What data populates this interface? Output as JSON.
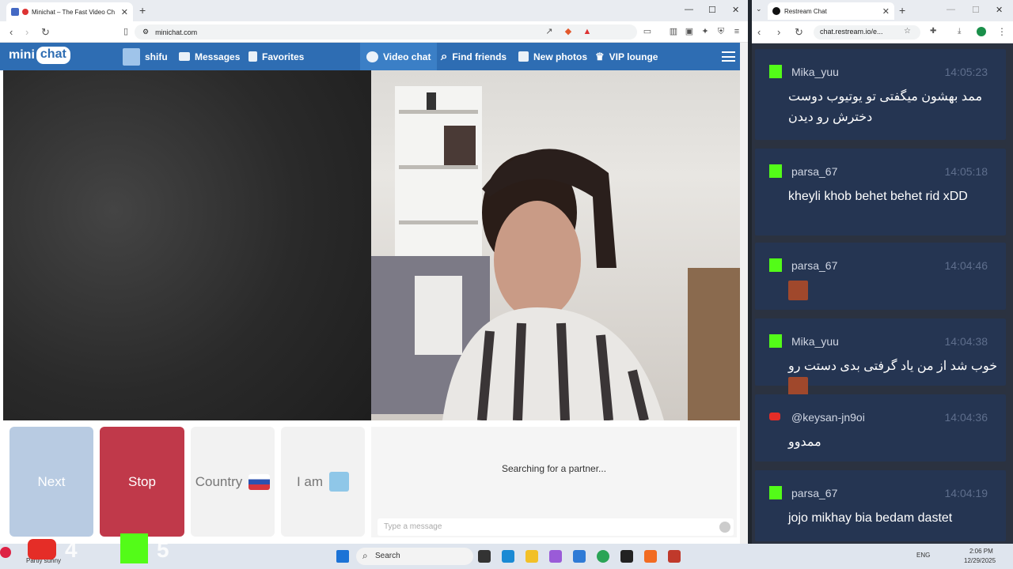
{
  "left_browser": {
    "tab_title": "Minichat – The Fast Video Ch",
    "tab_close": "✕",
    "new_tab": "+",
    "url": "minichat.com",
    "window_controls": [
      "—",
      "☐",
      "✕"
    ]
  },
  "site": {
    "logo_text_1": "mini",
    "logo_text_2": "chat",
    "nav": {
      "user": "shifu",
      "messages": "Messages",
      "favorites": "Favorites",
      "video_chat": "Video chat",
      "find_friends": "Find friends",
      "new_photos": "New photos",
      "vip_lounge": "VIP lounge"
    },
    "controls": {
      "next": "Next",
      "stop": "Stop",
      "country": "Country",
      "iam": "I am"
    },
    "status": "Searching for a partner...",
    "message_placeholder": "Type a message",
    "colors": {
      "brand": "#2e6db3",
      "stop": "#c0394a",
      "next": "#b8cbe2"
    }
  },
  "right_browser": {
    "tab_title": "Restream Chat",
    "url": "chat.restream.io/e..."
  },
  "chat_messages": [
    {
      "platform": "kick",
      "user": "Mika_yuu",
      "time": "14:05:23",
      "text": "ممد بهشون میگفتی تو یوتیوب دوست دخترش رو دیدن",
      "rtl": true
    },
    {
      "platform": "kick",
      "user": "parsa_67",
      "time": "14:05:18",
      "text": "kheyli khob behet behet rid xDD",
      "rtl": false
    },
    {
      "platform": "kick",
      "user": "parsa_67",
      "time": "14:04:46",
      "text": "",
      "emote": true
    },
    {
      "platform": "kick",
      "user": "Mika_yuu",
      "time": "14:04:38",
      "text": "خوب شد از من یاد گرفتی بدی دستت رو",
      "rtl": true,
      "emote": true
    },
    {
      "platform": "youtube",
      "user": "@keysan-jn9oi",
      "time": "14:04:36",
      "text": "ممدوو",
      "rtl": true
    },
    {
      "platform": "kick",
      "user": "parsa_67",
      "time": "14:04:19",
      "text": "jojo mikhay bia bedam dastet",
      "rtl": false
    }
  ],
  "overlay": {
    "youtube_count": "4",
    "kick_count": "5",
    "weather": "Partly sunny"
  },
  "taskbar": {
    "search": "Search",
    "lang": "ENG",
    "time": "2:06 PM",
    "date": "12/29/2025"
  }
}
